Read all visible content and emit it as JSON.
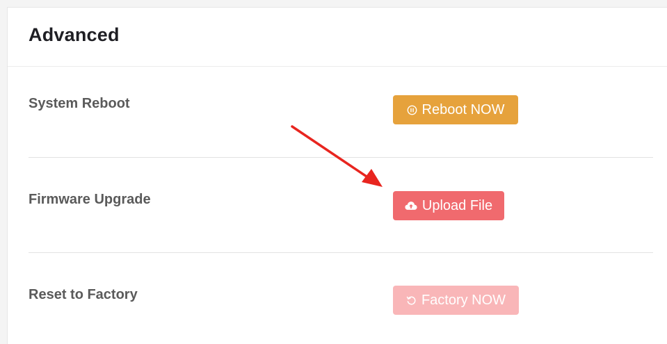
{
  "header": {
    "title": "Advanced"
  },
  "rows": [
    {
      "label": "System Reboot",
      "button_label": "Reboot NOW",
      "button_icon": "pause-circle-icon",
      "button_color": "#e6a23c"
    },
    {
      "label": "Firmware Upgrade",
      "button_label": "Upload File",
      "button_icon": "cloud-upload-icon",
      "button_color": "#f06a6e"
    },
    {
      "label": "Reset to Factory",
      "button_label": "Factory NOW",
      "button_icon": "refresh-icon",
      "button_color": "#f9b6b8",
      "button_disabled": true
    }
  ],
  "annotation": {
    "arrow_color": "#e8251f",
    "points_to": "upload-file-button"
  }
}
